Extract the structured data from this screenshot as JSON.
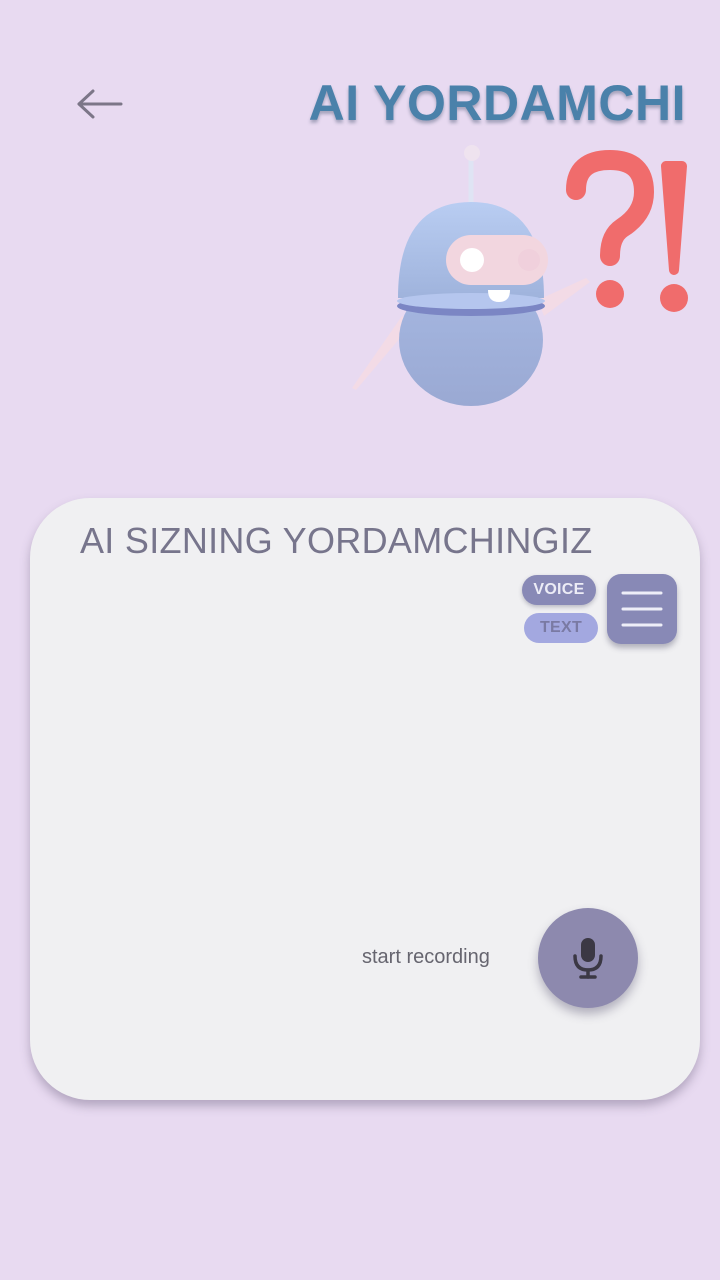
{
  "header": {
    "title": "AI YORDAMCHI",
    "back_icon": "arrow-left-icon"
  },
  "illustration": {
    "subject": "robot-mascot",
    "symbols": "?!"
  },
  "card": {
    "title": "AI SIZNING YORDAMCHINGIZ",
    "mode_options": [
      "VOICE",
      "TEXT"
    ],
    "voice_label": "VOICE",
    "text_label": "TEXT",
    "menu_icon": "hamburger-menu-icon",
    "record_label": "start recording",
    "mic_icon": "microphone-icon"
  },
  "colors": {
    "background": "#e8daf1",
    "title": "#4a81aa",
    "card": "#f0f0f2",
    "accent": "#8889b6",
    "chip_inactive": "#a3a8e0",
    "mic_button": "#8d89ae"
  }
}
